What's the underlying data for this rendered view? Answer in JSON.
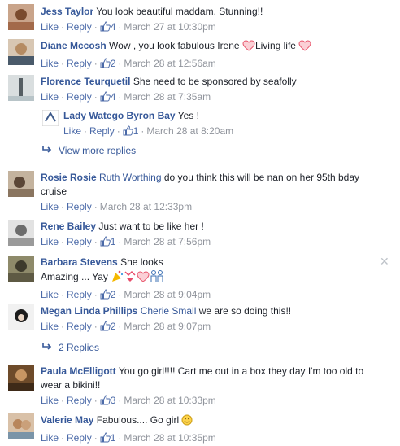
{
  "actions": {
    "like": "Like",
    "reply": "Reply",
    "sep": "·"
  },
  "comments": [
    {
      "name": "Jess Taylor",
      "text": "You look beautiful maddam. Stunning!!",
      "likes": "4",
      "time": "March 27 at 10:30pm"
    },
    {
      "name": "Diane Mccosh",
      "text1": "Wow , you look fabulous Irene",
      "text2": "Living life",
      "likes": "2",
      "time": "March 28 at 12:56am"
    },
    {
      "name": "Florence Teurquetil",
      "text": "She need to be sponsored by seafolly",
      "likes": "4",
      "time": "March 28 at 7:35am"
    },
    {
      "name": "Lady Watego Byron Bay",
      "text": "Yes !",
      "likes": "1",
      "time": "March 28 at 8:20am"
    },
    {
      "name": "Rosie Rosie",
      "mention": "Ruth Worthing",
      "text": "do you think this will be nan on her 95th bday",
      "text_line2": "cruise",
      "time": "March 28 at 12:33pm"
    },
    {
      "name": "Rene Bailey",
      "text": "Just want to be like her !",
      "likes": "1",
      "time": "March 28 at 7:56pm"
    },
    {
      "name": "Barbara Stevens",
      "text": "She looks",
      "text_line2": "Amazing ... Yay",
      "likes": "2",
      "time": "March 28 at 9:04pm"
    },
    {
      "name": "Megan Linda Phillips",
      "mention": "Cherie Small",
      "text": "we are so doing this!!",
      "likes": "2",
      "time": "March 28 at 9:07pm"
    },
    {
      "name": "Paula McElligott",
      "text": "You go girl!!!! Cart me out in a box they day I'm too old to",
      "text_line2": "wear a bikini!!",
      "likes": "3",
      "time": "March 28 at 10:33pm"
    },
    {
      "name": "Valerie May",
      "text": "Fabulous.... Go girl",
      "likes": "1",
      "time": "March 28 at 10:35pm"
    }
  ],
  "view_more": "View more replies",
  "replies_link": "2 Replies",
  "colors": {
    "link": "#365899",
    "meta": "#90949c",
    "heart": "#f25268"
  }
}
